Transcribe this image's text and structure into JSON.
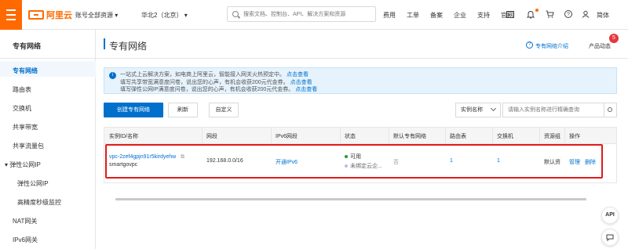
{
  "topbar": {
    "logo_text": "阿里云",
    "account_select": "账号全部资源",
    "region_select": "华北2（北京）",
    "search_placeholder": "搜索文档、控制台、API、解决方案和资源",
    "nav": [
      "费用",
      "工单",
      "备案",
      "企业",
      "支持",
      "官网"
    ],
    "lang": "简体"
  },
  "sidebar": {
    "title": "专有网络",
    "items": [
      {
        "label": "专有网络",
        "active": true
      },
      {
        "label": "路由表"
      },
      {
        "label": "交换机"
      },
      {
        "label": "共享带宽"
      },
      {
        "label": "共享流量包"
      },
      {
        "label": "弹性公网IP",
        "expanded": true
      },
      {
        "label": "弹性公网IP"
      },
      {
        "label": "高精度秒级监控"
      },
      {
        "label": "NAT网关"
      },
      {
        "label": "IPv6网关"
      }
    ]
  },
  "page": {
    "title": "专有网络",
    "intro_link": "专有网络介绍",
    "product_news": "产品动态",
    "news_count": "5"
  },
  "notice": {
    "line1": "一站式上云解决方案，如电商上阿里云，智能接入网关火热预定中。",
    "line1_link": "点击查看",
    "line2": "填写共享带宽满意度问卷，说出您的心声，有机会收获200元代金券。",
    "line2_link": "点击查看",
    "line3": "填写弹性公网IP满意度问卷，说出您的心声，有机会收获200元代金券。",
    "line3_link": "点击查看"
  },
  "toolbar": {
    "create": "创建专有网络",
    "refresh": "刷新",
    "custom": "自定义",
    "filter_select": "实例名称",
    "filter_placeholder": "请输入实例名称进行精确查询"
  },
  "table": {
    "headers": [
      "实例ID/名称",
      "网段",
      "IPv6网段",
      "状态",
      "默认专有网络",
      "路由表",
      "交换机",
      "资源组",
      "操作"
    ],
    "row": {
      "id": "vpc-2zef4gpjn91r5kirdyehw",
      "name": "smartgovpc",
      "cidr": "192.168.0.0/16",
      "ipv6": "开通IPv6",
      "status": "可用",
      "status_sub": "未绑定云企...",
      "default_vpc": "否",
      "route_tables": "1",
      "vswitches": "1",
      "resource_group": "默认资",
      "action_manage": "管理",
      "action_delete": "删除"
    }
  },
  "floating": {
    "api": "API"
  },
  "colors": {
    "brand": "#ff6a00",
    "primary": "#0070cc",
    "highlight": "#e01b1b",
    "status_ok": "#1e9c2c"
  }
}
